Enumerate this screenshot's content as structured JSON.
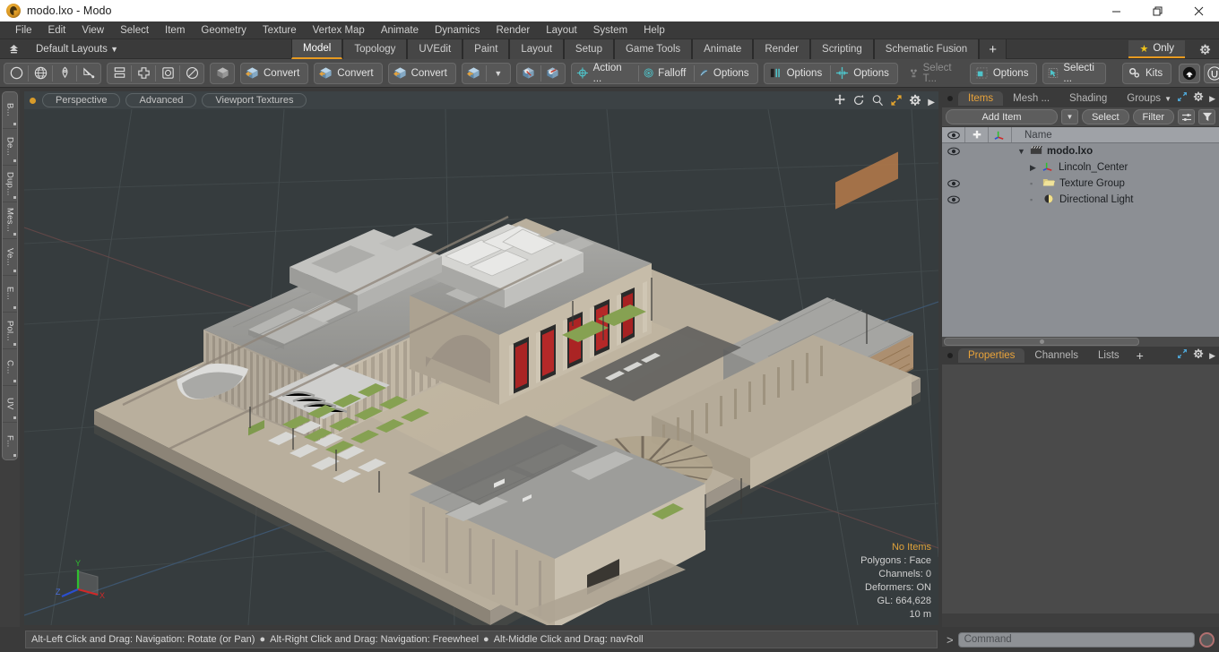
{
  "window": {
    "title": "modo.lxo - Modo",
    "app_icon": "modo-logo-icon",
    "minimize": "minimize-icon",
    "maximize": "restore-icon",
    "close": "close-icon"
  },
  "menubar": {
    "items": [
      "File",
      "Edit",
      "View",
      "Select",
      "Item",
      "Geometry",
      "Texture",
      "Vertex Map",
      "Animate",
      "Dynamics",
      "Render",
      "Layout",
      "System",
      "Help"
    ]
  },
  "layoutbar": {
    "home_icon": "home-up-icon",
    "layouts_label": "Default Layouts",
    "tabs": [
      {
        "label": "Model",
        "active": true
      },
      {
        "label": "Topology",
        "active": false
      },
      {
        "label": "UVEdit",
        "active": false
      },
      {
        "label": "Paint",
        "active": false
      },
      {
        "label": "Layout",
        "active": false
      },
      {
        "label": "Setup",
        "active": false
      },
      {
        "label": "Game Tools",
        "active": false
      },
      {
        "label": "Animate",
        "active": false
      },
      {
        "label": "Render",
        "active": false
      },
      {
        "label": "Scripting",
        "active": false
      },
      {
        "label": "Schematic Fusion",
        "active": false
      }
    ],
    "add_tab_label": "+",
    "only_label": "Only",
    "star_icon": "star-icon",
    "gear_icon": "gear-icon"
  },
  "toolbar": {
    "groups": [
      {
        "name": "primitives",
        "buttons": [
          {
            "icon": "circle-outline-icon",
            "label": ""
          },
          {
            "icon": "globe-icon",
            "label": ""
          },
          {
            "icon": "pen-tool-icon",
            "label": ""
          },
          {
            "icon": "curve-tool-icon",
            "label": ""
          }
        ]
      },
      {
        "name": "mesh-ops",
        "buttons": [
          {
            "icon": "stack-icon",
            "label": ""
          },
          {
            "icon": "crosshair-box-icon",
            "label": ""
          },
          {
            "icon": "rounded-square-icon",
            "label": ""
          },
          {
            "icon": "disc-icon",
            "label": ""
          }
        ]
      },
      {
        "name": "mesh-mode",
        "buttons": [
          {
            "icon": "grey-cube-icon",
            "label": ""
          }
        ]
      },
      {
        "name": "convert-1",
        "buttons": [
          {
            "icon": "convert-cube-icon",
            "label": "Convert"
          }
        ]
      },
      {
        "name": "convert-2",
        "buttons": [
          {
            "icon": "convert-cube-icon",
            "label": "Convert"
          }
        ]
      },
      {
        "name": "convert-3",
        "buttons": [
          {
            "icon": "convert-cube-icon",
            "label": "Convert"
          }
        ]
      },
      {
        "name": "convert-dropdown",
        "buttons": [
          {
            "icon": "convert-cube-icon",
            "label": ""
          },
          {
            "icon": "chevron-down-icon",
            "label": ""
          }
        ]
      },
      {
        "name": "snapping",
        "buttons": [
          {
            "icon": "snap-cube-icon",
            "label": ""
          },
          {
            "icon": "snap-cube-alt-icon",
            "label": ""
          }
        ]
      },
      {
        "name": "action-falloff-options",
        "buttons": [
          {
            "icon": "action-center-icon",
            "label": "Action  ..."
          },
          {
            "icon": "falloff-icon",
            "label": "Falloff"
          },
          {
            "icon": "snap-options-icon",
            "label": "Options"
          }
        ]
      },
      {
        "name": "symmetry-options",
        "buttons": [
          {
            "icon": "symmetry-icon",
            "label": "Options"
          }
        ]
      },
      {
        "name": "workplane-options",
        "buttons": [
          {
            "icon": "workplane-icon",
            "label": "Options"
          }
        ]
      },
      {
        "name": "select-through",
        "buttons": [
          {
            "icon": "select-through-icon",
            "label": "Select T...",
            "dim": true
          }
        ]
      },
      {
        "name": "lasso-options",
        "buttons": [
          {
            "icon": "lasso-options-icon",
            "label": "Options"
          }
        ]
      },
      {
        "name": "selection-set",
        "buttons": [
          {
            "icon": "selection-arrow-icon",
            "label": "Selecti ..."
          }
        ]
      },
      {
        "name": "kits",
        "buttons": [
          {
            "icon": "kits-gears-icon",
            "label": "Kits"
          }
        ]
      },
      {
        "name": "plugins",
        "buttons": [
          {
            "icon": "modo-badge-icon",
            "label": ""
          },
          {
            "icon": "unreal-badge-icon",
            "label": ""
          }
        ]
      }
    ]
  },
  "left_strip": {
    "tabs": [
      "B...",
      "De...",
      "Dup...",
      "Mes...",
      "Ve...",
      "E...",
      "Pol...",
      "C...",
      "UV",
      "F..."
    ]
  },
  "viewport": {
    "dot_color": "#d89b2a",
    "tabs": [
      "Perspective",
      "Advanced",
      "Viewport Textures"
    ],
    "icons": [
      "pan-icon",
      "rotate-icon",
      "zoom-icon",
      "maximize-icon",
      "gear-icon",
      "chevron-right-icon"
    ],
    "background_color": "#363c3e",
    "stats": {
      "selection": "No Items",
      "polygons": "Polygons : Face",
      "channels": "Channels: 0",
      "deformers": "Deformers: ON",
      "gl": "GL: 664,628",
      "scale": "10 m"
    },
    "axis_labels": {
      "x": "X",
      "y": "Y",
      "z": "Z"
    }
  },
  "right_panel": {
    "top_tabs": [
      {
        "label": "Items",
        "active": true
      },
      {
        "label": "Mesh ...",
        "active": false
      },
      {
        "label": "Shading",
        "active": false
      },
      {
        "label": "Groups",
        "active": false
      }
    ],
    "top_tab_right_icons": [
      "chevron-down-icon",
      "expand-icon",
      "gear-icon",
      "chevron-right-icon"
    ],
    "toolrow": {
      "add_item_label": "Add Item",
      "add_item_dropdown": "chevron-down-icon",
      "select_label": "Select",
      "filter_label": "Filter",
      "list_icon": "list-toggle-icon",
      "funnel_icon": "funnel-icon"
    },
    "list_headers": {
      "eye": "eye-icon",
      "lock": "cross-icon",
      "axis": "axis-icon",
      "name": "Name"
    },
    "items": [
      {
        "name": "modo.lxo",
        "icon": "scene-clapper-icon",
        "depth": 0,
        "bold": true,
        "eye": true,
        "expander": "expanded"
      },
      {
        "name": "Lincoln_Center",
        "icon": "mesh-axis-icon",
        "depth": 1,
        "bold": false,
        "eye": false,
        "expander": "collapsed"
      },
      {
        "name": "Texture Group",
        "icon": "folder-icon",
        "depth": 1,
        "bold": false,
        "eye": true,
        "expander": "leaf"
      },
      {
        "name": "Directional Light",
        "icon": "light-icon",
        "depth": 1,
        "bold": false,
        "eye": true,
        "expander": "leaf"
      }
    ],
    "bottom_tabs": [
      {
        "label": "Properties",
        "active": true
      },
      {
        "label": "Channels",
        "active": false
      },
      {
        "label": "Lists",
        "active": false
      },
      {
        "label": "+",
        "active": false
      }
    ],
    "bottom_tab_right_icons": [
      "expand-icon",
      "gear-icon",
      "chevron-right-icon"
    ]
  },
  "statusbar": {
    "hints": [
      "Alt-Left Click and Drag: Navigation: Rotate (or Pan)",
      "Alt-Right Click and Drag: Navigation: Freewheel",
      "Alt-Middle Click and Drag: navRoll"
    ],
    "separator": "●",
    "command_prompt": ">",
    "command_placeholder": "Command",
    "command_value": "",
    "record_icon": "record-icon"
  },
  "colors": {
    "accent": "#e79a20",
    "panel_bg": "#3a3a3a",
    "toolbar_bg": "#4a4a4a",
    "list_bg": "#8c8f94",
    "viewport_bg": "#363c3e"
  }
}
